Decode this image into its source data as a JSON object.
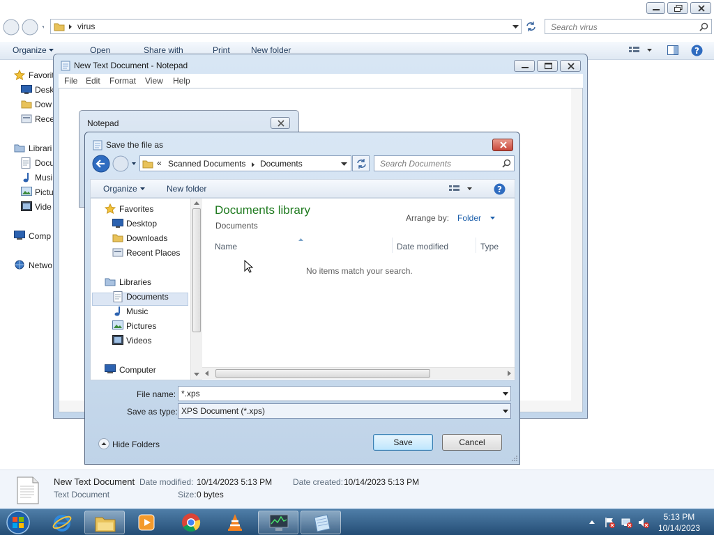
{
  "explorer": {
    "address_folder": "virus",
    "search_placeholder": "Search virus",
    "commands": {
      "organize": "Organize",
      "open": "Open",
      "share_with": "Share with",
      "print": "Print",
      "new_folder": "New folder"
    },
    "nav": {
      "favorites": "Favorit",
      "desktop": "Desk",
      "downloads": "Dow",
      "recent": "Rece",
      "libraries": "Librari",
      "documents": "Docu",
      "music": "Musi",
      "pictures": "Pictu",
      "videos": "Vide",
      "computer": "Comp",
      "network": "Netwo"
    },
    "details": {
      "file_name": "New Text Document",
      "file_type": "Text Document",
      "date_modified_label": "Date modified:",
      "date_modified": "10/14/2023 5:13 PM",
      "date_created_label": "Date created:",
      "date_created": "10/14/2023 5:13 PM",
      "size_label": "Size:",
      "size": "0 bytes"
    }
  },
  "notepad": {
    "title": "New Text Document - Notepad",
    "menu": [
      "File",
      "Edit",
      "Format",
      "View",
      "Help"
    ],
    "msg_title": "Notepad"
  },
  "save_dialog": {
    "title": "Save the file as",
    "breadcrumb": {
      "prefix": "«",
      "parent": "Scanned Documents",
      "current": "Documents"
    },
    "search_placeholder": "Search Documents",
    "organize": "Organize",
    "new_folder": "New folder",
    "tree": {
      "favorites": "Favorites",
      "desktop": "Desktop",
      "downloads": "Downloads",
      "recent_places": "Recent Places",
      "libraries": "Libraries",
      "documents": "Documents",
      "music": "Music",
      "pictures": "Pictures",
      "videos": "Videos",
      "computer": "Computer"
    },
    "library_title": "Documents library",
    "library_subtitle": "Documents",
    "arrange_by_label": "Arrange by:",
    "arrange_by_value": "Folder",
    "columns": {
      "name": "Name",
      "date_modified": "Date modified",
      "type": "Type"
    },
    "empty_message": "No items match your search.",
    "file_name_label": "File name:",
    "file_name_value": "*.xps",
    "save_as_type_label": "Save as type:",
    "save_as_type_value": "XPS Document (*.xps)",
    "hide_folders": "Hide Folders",
    "save_button": "Save",
    "cancel_button": "Cancel"
  },
  "taskbar": {
    "time": "5:13 PM",
    "date": "10/14/2023"
  },
  "colors": {
    "library_title": "#1f7a1f",
    "taskbar": "#2f5c88",
    "close_button": "#c9473a"
  }
}
